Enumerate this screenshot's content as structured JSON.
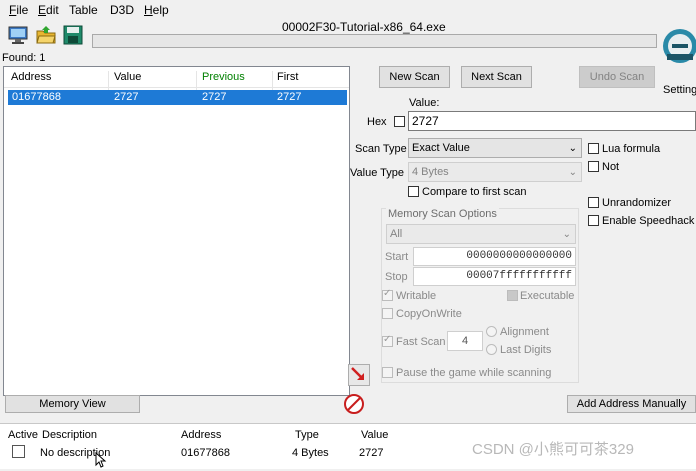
{
  "menu": [
    {
      "label": "File",
      "u": "F",
      "rest": "ile"
    },
    {
      "label": "Edit",
      "u": "E",
      "rest": "dit"
    },
    {
      "label": "Table",
      "u": "",
      "rest": "Table"
    },
    {
      "label": "D3D",
      "u": "",
      "rest": "D3D"
    },
    {
      "label": "Help",
      "u": "H",
      "rest": "elp"
    }
  ],
  "window": {
    "title": "00002F30-Tutorial-x86_64.exe"
  },
  "toolbar": {
    "open_process_icon": "computer-monitor-icon",
    "open_file_icon": "folder-open-icon",
    "save_icon": "floppy-save-icon"
  },
  "found_label": "Found: 1",
  "results": {
    "headers": [
      "Address",
      "Value",
      "Previous",
      "First"
    ],
    "previous_color": "#008000",
    "rows": [
      {
        "address": "01677868",
        "value": "2727",
        "previous": "2727",
        "first": "2727"
      }
    ]
  },
  "scan": {
    "new_scan": "New Scan",
    "next_scan": "Next Scan",
    "undo_scan": "Undo Scan",
    "settings": "Settings",
    "value_label": "Value:",
    "hex_label": "Hex",
    "value": "2727",
    "scan_type_label": "Scan Type",
    "scan_type": "Exact Value",
    "value_type_label": "Value Type",
    "value_type": "4 Bytes",
    "compare_first": "Compare to first scan",
    "lua_formula": "Lua formula",
    "not_label": "Not",
    "unrandomizer": "Unrandomizer",
    "enable_speedhack": "Enable Speedhack"
  },
  "memory_options": {
    "title": "Memory Scan Options",
    "region": "All",
    "start_label": "Start",
    "start": "0000000000000000",
    "stop_label": "Stop",
    "stop": "00007fffffffffff",
    "writable": "Writable",
    "executable": "Executable",
    "copy_on_write": "CopyOnWrite",
    "fast_scan": "Fast Scan",
    "fast_scan_value": "4",
    "alignment": "Alignment",
    "last_digits": "Last Digits",
    "pause": "Pause the game while scanning"
  },
  "memory_view": "Memory View",
  "add_address": "Add Address Manually",
  "address_table": {
    "headers": [
      "Active",
      "Description",
      "Address",
      "Type",
      "Value"
    ],
    "rows": [
      {
        "description": "No description",
        "address": "01677868",
        "type": "4 Bytes",
        "value": "2727"
      }
    ]
  },
  "watermark": "CSDN @小熊可可茶329"
}
